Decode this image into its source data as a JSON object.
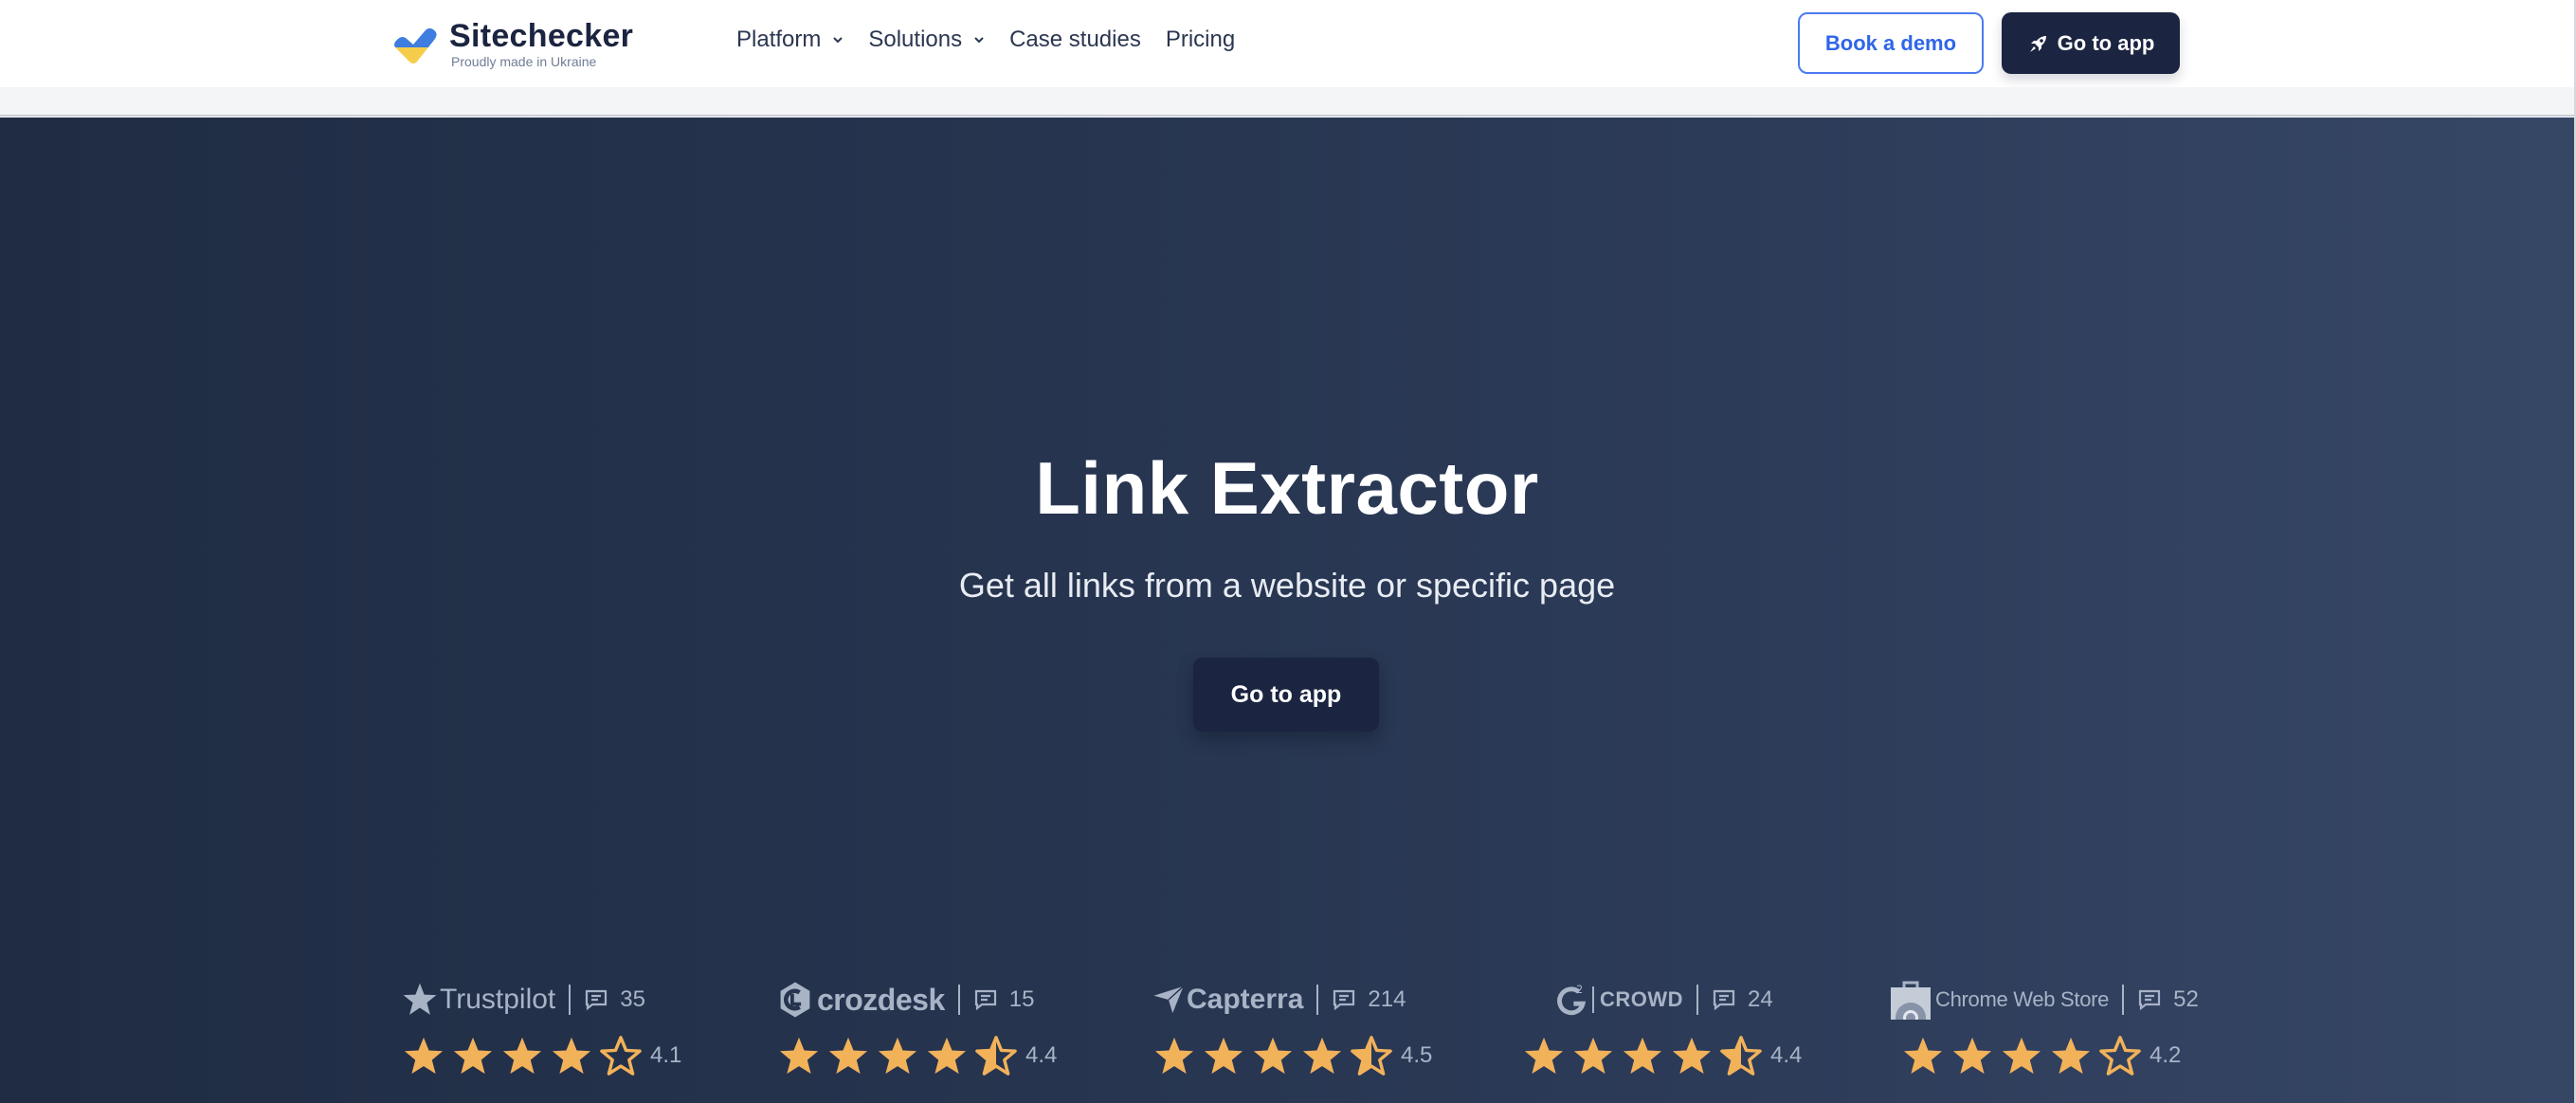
{
  "header": {
    "logo": {
      "name": "Sitechecker",
      "tagline": "Proudly made in Ukraine"
    },
    "nav": [
      {
        "label": "Platform",
        "has_dropdown": true
      },
      {
        "label": "Solutions",
        "has_dropdown": true
      },
      {
        "label": "Case studies",
        "has_dropdown": false
      },
      {
        "label": "Pricing",
        "has_dropdown": false
      }
    ],
    "book_demo_label": "Book a demo",
    "go_to_app_label": "Go to app"
  },
  "hero": {
    "title": "Link Extractor",
    "subtitle": "Get all links from a website or specific page",
    "cta_label": "Go to app"
  },
  "reviews": [
    {
      "platform": "Trustpilot",
      "icon": "trustpilot-star-icon",
      "review_count": "35",
      "rating": "4.1",
      "stars_value": 4.1
    },
    {
      "platform": "crozdesk",
      "icon": "crozdesk-logo-icon",
      "review_count": "15",
      "rating": "4.4",
      "stars_value": 4.4
    },
    {
      "platform": "Capterra",
      "icon": "capterra-arrow-icon",
      "review_count": "214",
      "rating": "4.5",
      "stars_value": 4.5
    },
    {
      "platform": "CROWD",
      "icon": "g2-logo-icon",
      "review_count": "24",
      "rating": "4.4",
      "stars_value": 4.4
    },
    {
      "platform": "Chrome Web Store",
      "icon": "chrome-web-store-icon",
      "review_count": "52",
      "rating": "4.2",
      "stars_value": 4.2
    }
  ],
  "colors": {
    "brand_dark": "#1b2440",
    "accent_blue": "#2f66e8",
    "star": "#f2b25a",
    "muted_text": "#a8b3c6",
    "ukraine_blue": "#3f7de0",
    "ukraine_yellow": "#f5cd4b"
  }
}
